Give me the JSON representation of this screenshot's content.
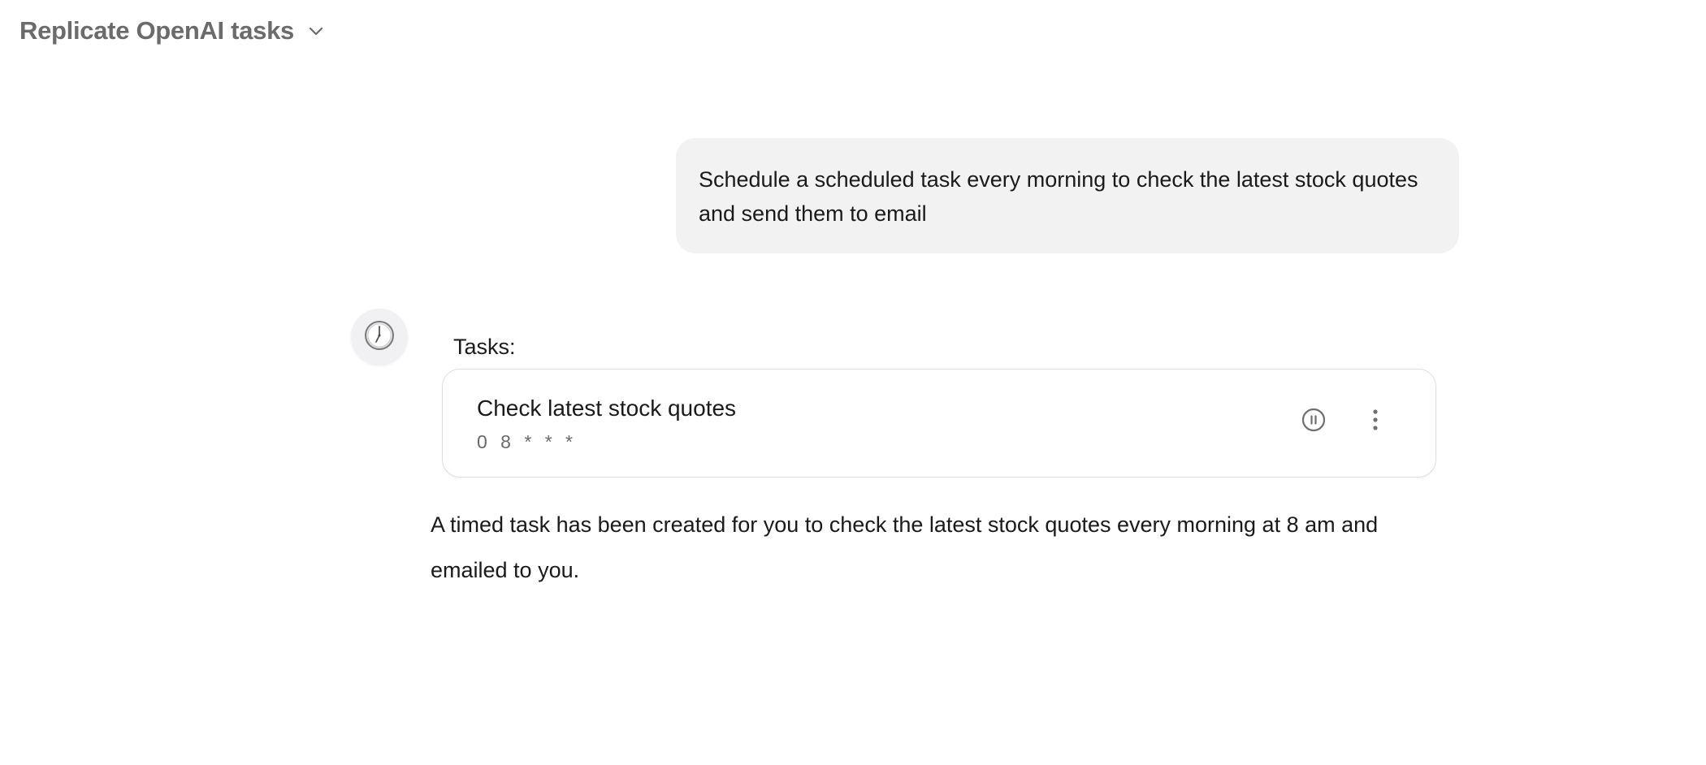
{
  "header": {
    "title": "Replicate OpenAI tasks",
    "dropdown_icon": "chevron-down-icon"
  },
  "conversation": {
    "user_message": "Schedule a scheduled task every morning to check the latest stock quotes and send them to email",
    "assistant": {
      "avatar_icon": "clock-icon",
      "tasks_label": "Tasks:",
      "task": {
        "name": "Check latest stock quotes",
        "schedule": "0 8 * * *",
        "pause_icon": "pause-icon",
        "more_icon": "more-vertical-icon"
      },
      "response": "A timed task has been created for you to check the latest stock quotes every morning at 8 am and emailed to you."
    }
  },
  "colors": {
    "title": "#6b6b6b",
    "bubble_bg": "#f2f2f2",
    "card_border": "#dedede",
    "secondary_text": "#6a6a6a"
  }
}
